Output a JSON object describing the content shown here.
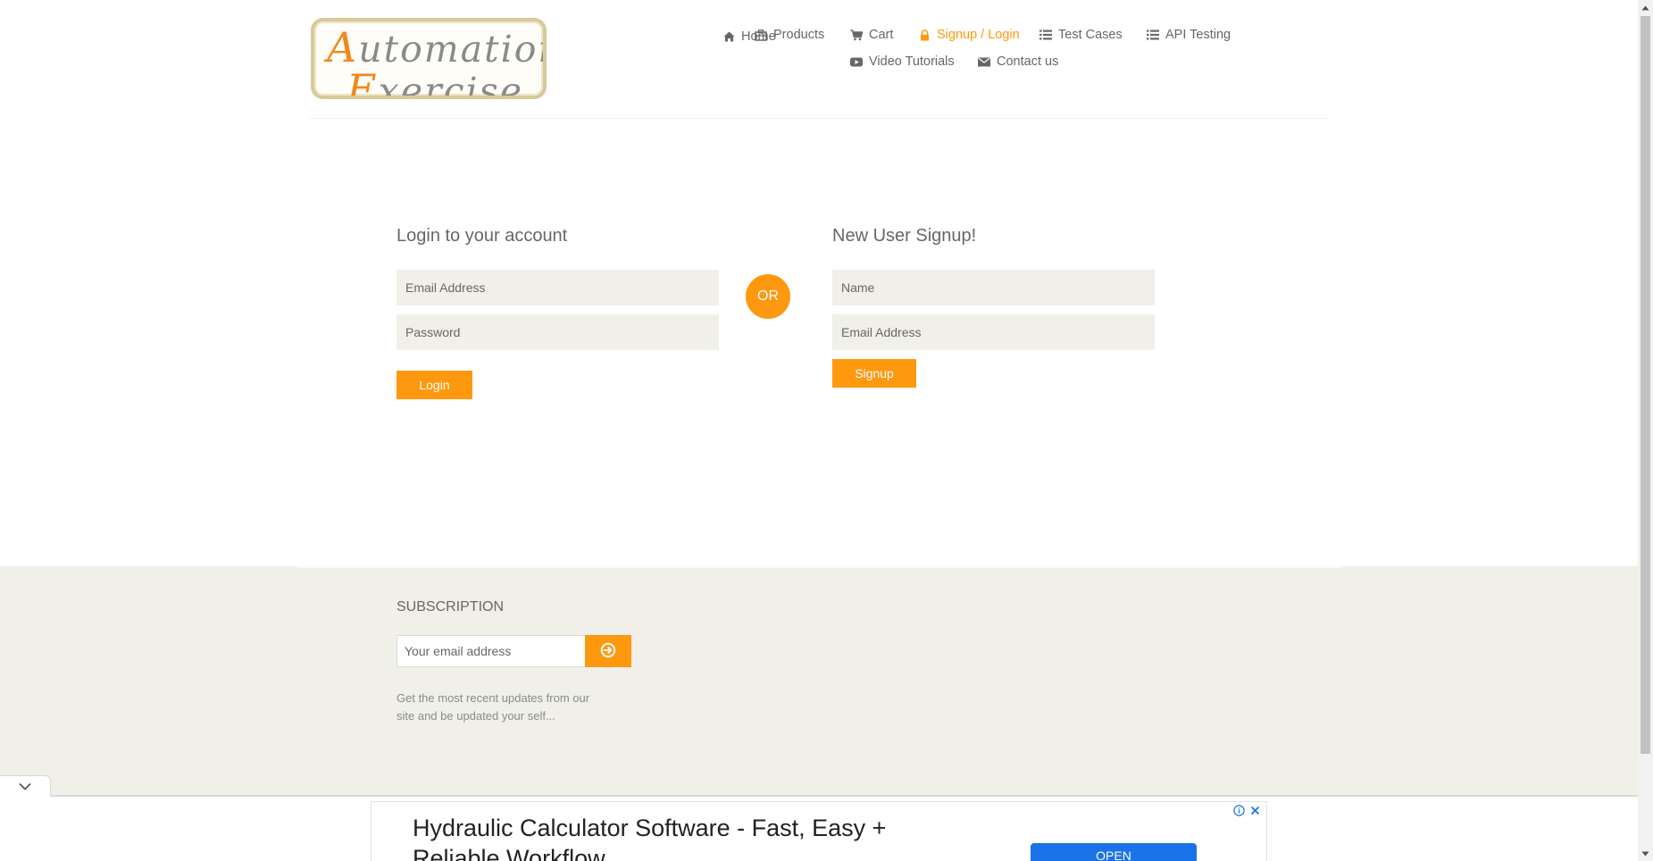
{
  "logo": {
    "line1_cap": "A",
    "line1_rest": "utomation",
    "line2_cap": "E",
    "line2_rest": "xercise"
  },
  "nav": {
    "items": [
      {
        "label": "Home",
        "icon": "home-icon"
      },
      {
        "label": "Products",
        "icon": "products-icon"
      },
      {
        "label": "Cart",
        "icon": "cart-icon"
      },
      {
        "label": "Signup / Login",
        "icon": "lock-icon",
        "active": true
      },
      {
        "label": "Test Cases",
        "icon": "list-icon"
      },
      {
        "label": "API Testing",
        "icon": "list-icon"
      },
      {
        "label": "Video Tutorials",
        "icon": "youtube-play-icon"
      },
      {
        "label": "Contact us",
        "icon": "envelope-icon"
      }
    ]
  },
  "login": {
    "title": "Login to your account",
    "email_placeholder": "Email Address",
    "password_placeholder": "Password",
    "button_label": "Login"
  },
  "divider": {
    "or_label": "OR"
  },
  "signup": {
    "title": "New User Signup!",
    "name_placeholder": "Name",
    "email_placeholder": "Email Address",
    "button_label": "Signup"
  },
  "footer": {
    "subscription_title": "SUBSCRIPTION",
    "email_placeholder": "Your email address",
    "description": "Get the most recent updates from our site and be updated your self..."
  },
  "ad": {
    "headline": "Hydraulic Calculator Software - Fast, Easy + Reliable Workflow",
    "cta_label": "OPEN",
    "info_icon": "ad-info-icon",
    "close_icon": "ad-close-icon"
  },
  "colors": {
    "accent": "#fe980f",
    "text": "#696763",
    "input_bg": "#f0f0e9",
    "footer_bg": "#f0f0e9",
    "ad_button": "#1a73e8"
  }
}
